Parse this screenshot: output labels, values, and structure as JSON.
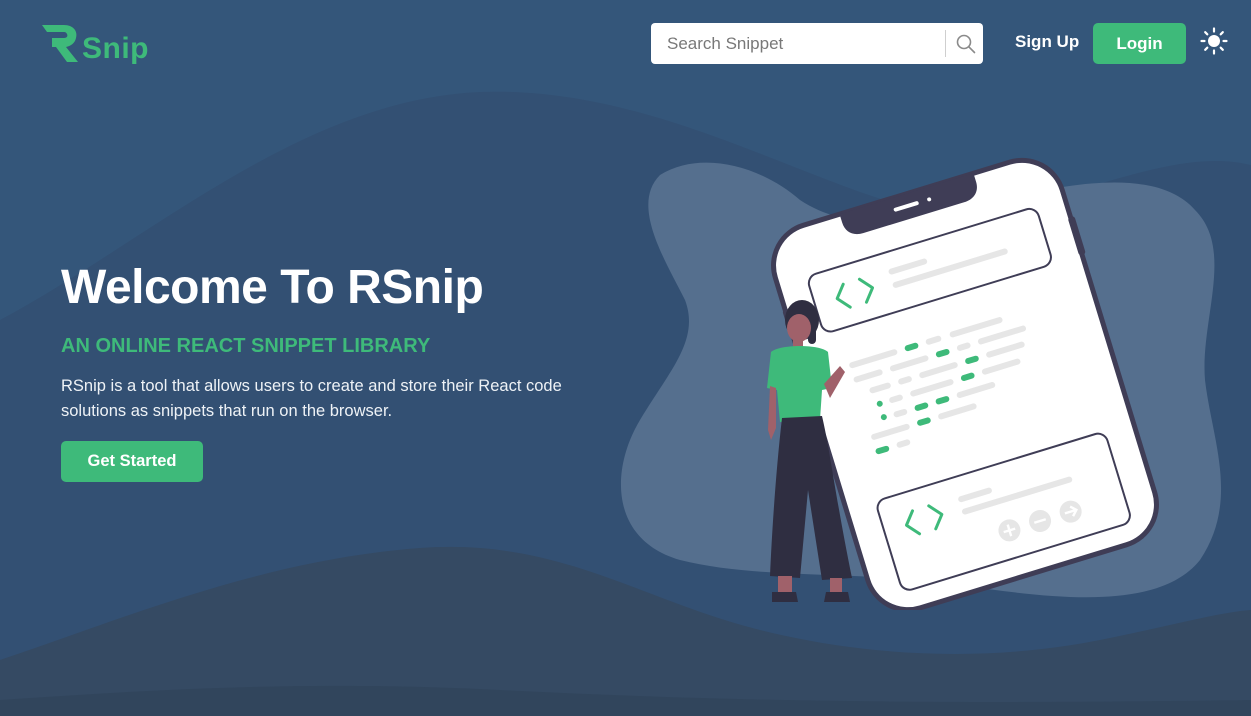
{
  "brand": {
    "logo_letter": "R",
    "name": "Snip"
  },
  "search": {
    "placeholder": "Search Snippet",
    "value": ""
  },
  "nav": {
    "signup_label": "Sign Up",
    "login_label": "Login"
  },
  "hero": {
    "title": "Welcome To RSnip",
    "subtitle": "AN ONLINE REACT SNIPPET LIBRARY",
    "description": "RSnip is a tool that allows users to create and store their React code solutions as snippets that run on the browser.",
    "cta_label": "Get Started"
  },
  "icons": {
    "search": "search-icon",
    "theme": "sun-icon",
    "code": "code-brackets-icon",
    "plus": "plus-icon",
    "minus": "minus-icon",
    "arrow": "arrow-right-icon"
  },
  "colors": {
    "background": "#34567a",
    "accent": "#3eba7a",
    "wave_light": "#557090",
    "wave_dark": "#2f4b66",
    "phone_frame": "#3f3d56"
  }
}
